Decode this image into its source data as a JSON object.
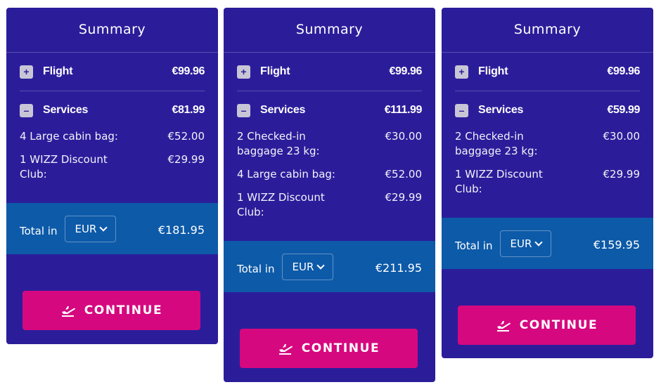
{
  "cards": [
    {
      "title": "Summary",
      "flight": {
        "toggle": "+",
        "label": "Flight",
        "price": "€99.96"
      },
      "services": {
        "toggle": "–",
        "label": "Services",
        "price": "€81.99",
        "items": [
          {
            "name": "4 Large cabin bag:",
            "price": "€52.00"
          },
          {
            "name": "1 WIZZ Discount Club:",
            "price": "€29.99"
          }
        ]
      },
      "total": {
        "label": "Total in",
        "currency": "EUR",
        "amount": "€181.95"
      },
      "continue_label": "CONTINUE"
    },
    {
      "title": "Summary",
      "flight": {
        "toggle": "+",
        "label": "Flight",
        "price": "€99.96"
      },
      "services": {
        "toggle": "–",
        "label": "Services",
        "price": "€111.99",
        "items": [
          {
            "name": "2 Checked-in baggage 23 kg:",
            "price": "€30.00"
          },
          {
            "name": "4 Large cabin bag:",
            "price": "€52.00"
          },
          {
            "name": "1 WIZZ Discount Club:",
            "price": "€29.99"
          }
        ]
      },
      "total": {
        "label": "Total in",
        "currency": "EUR",
        "amount": "€211.95"
      },
      "continue_label": "CONTINUE"
    },
    {
      "title": "Summary",
      "flight": {
        "toggle": "+",
        "label": "Flight",
        "price": "€99.96"
      },
      "services": {
        "toggle": "–",
        "label": "Services",
        "price": "€59.99",
        "items": [
          {
            "name": "2 Checked-in baggage 23 kg:",
            "price": "€30.00"
          },
          {
            "name": "1 WIZZ Discount Club:",
            "price": "€29.99"
          }
        ]
      },
      "total": {
        "label": "Total in",
        "currency": "EUR",
        "amount": "€159.95"
      },
      "continue_label": "CONTINUE"
    }
  ],
  "colors": {
    "card_bg": "#2b1d9a",
    "total_bg": "#0d5aa8",
    "button_bg": "#d6087f",
    "text": "#ffffff"
  },
  "icons": {
    "flight_toggle": "plus-icon",
    "services_toggle": "minus-icon",
    "continue": "airplane-takeoff-icon",
    "currency": "chevron-down-icon"
  }
}
